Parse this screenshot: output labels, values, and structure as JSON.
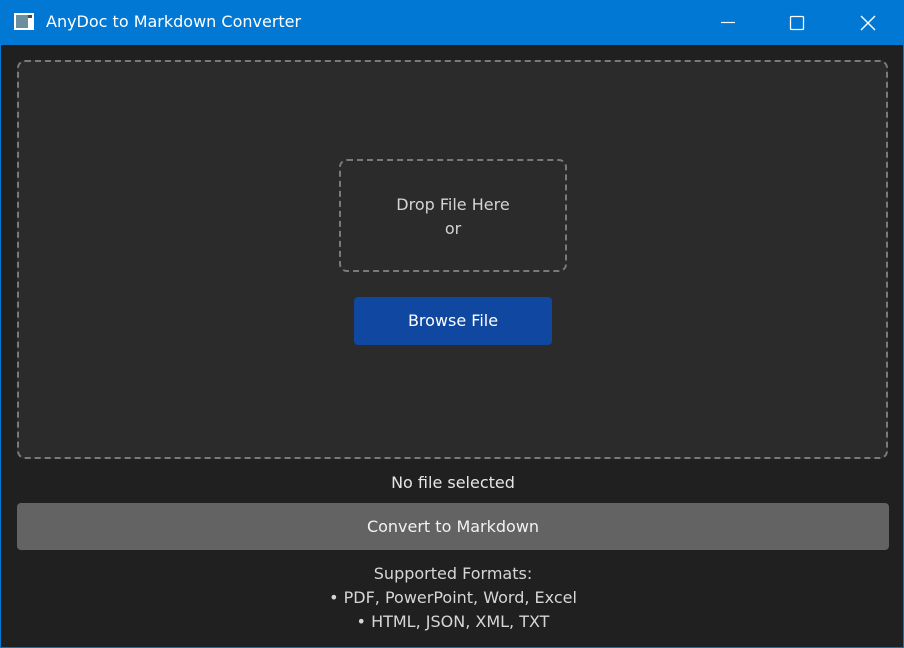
{
  "window": {
    "title": "AnyDoc to Markdown Converter",
    "accent_color": "#0078d4",
    "controls": {
      "minimize_icon": "minimize-icon",
      "maximize_icon": "maximize-icon",
      "close_icon": "close-icon"
    }
  },
  "drop_zone": {
    "line1": "Drop File Here",
    "line2": "or",
    "browse_label": "Browse File",
    "browse_color": "#0f47a1"
  },
  "status": {
    "text": "No file selected"
  },
  "convert": {
    "label": "Convert to Markdown"
  },
  "formats": {
    "heading": "Supported Formats:",
    "items": [
      "• PDF, PowerPoint, Word, Excel",
      "• HTML, JSON, XML, TXT"
    ]
  }
}
